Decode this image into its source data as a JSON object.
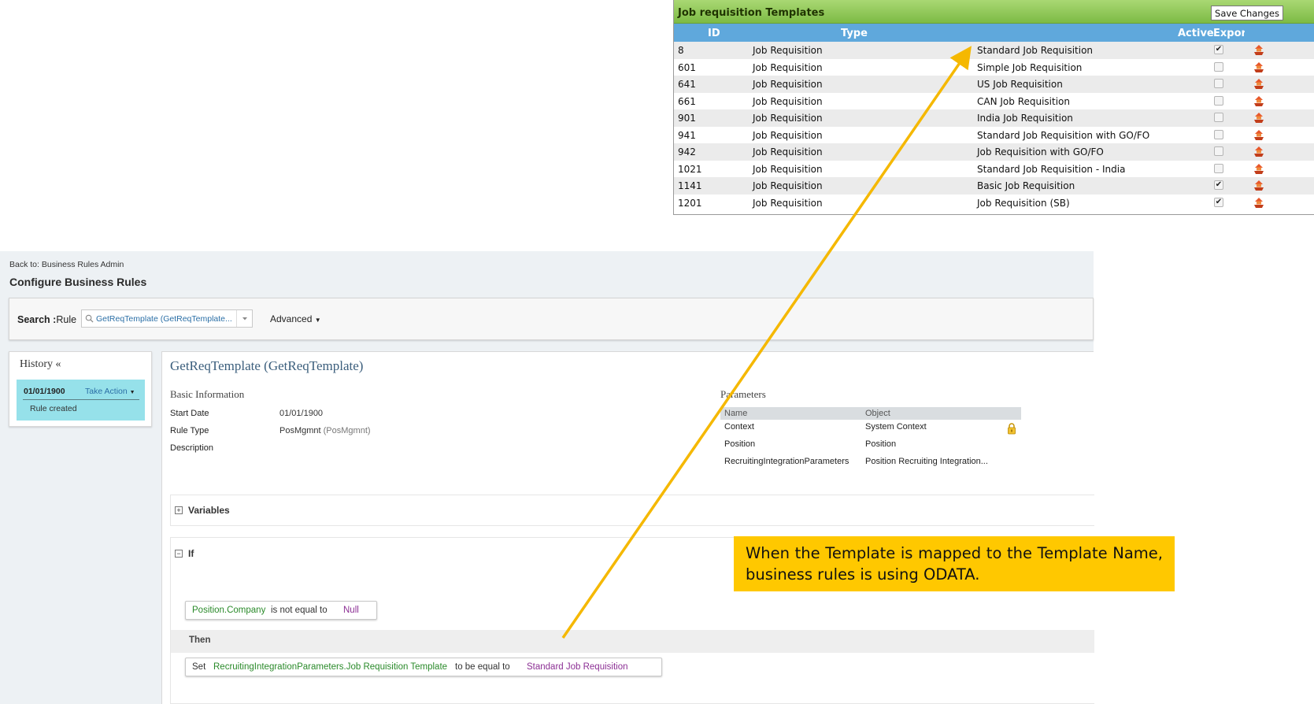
{
  "templates_panel": {
    "title": "Job requisition Templates",
    "save_label": "Save Changes",
    "columns": {
      "id": "ID",
      "type": "Type",
      "active": "Active",
      "export": "Export"
    },
    "rows": [
      {
        "id": "8",
        "type": "Job Requisition",
        "name": "Standard Job Requisition",
        "active": true
      },
      {
        "id": "601",
        "type": "Job Requisition",
        "name": "Simple Job Requisition",
        "active": false
      },
      {
        "id": "641",
        "type": "Job Requisition",
        "name": "US Job Requisition",
        "active": false
      },
      {
        "id": "661",
        "type": "Job Requisition",
        "name": "CAN Job Requisition",
        "active": false
      },
      {
        "id": "901",
        "type": "Job Requisition",
        "name": "India Job Requisition",
        "active": false
      },
      {
        "id": "941",
        "type": "Job Requisition",
        "name": "Standard Job Requisition with GO/FO",
        "active": false
      },
      {
        "id": "942",
        "type": "Job Requisition",
        "name": "Job Requisition with GO/FO",
        "active": false
      },
      {
        "id": "1021",
        "type": "Job Requisition",
        "name": "Standard Job Requisition - India",
        "active": false
      },
      {
        "id": "1141",
        "type": "Job Requisition",
        "name": "Basic Job Requisition",
        "active": true
      },
      {
        "id": "1201",
        "type": "Job Requisition",
        "name": "Job Requisition (SB)",
        "active": true
      }
    ],
    "export_icon": "export-icon",
    "header_color": "#7dbb45",
    "column_header_color": "#5fa8dc"
  },
  "page": {
    "back_link": "Back to: Business Rules Admin",
    "title": "Configure Business Rules",
    "search": {
      "label": "Search :",
      "scope": "Rule",
      "value": "GetReqTemplate (GetReqTemplate...",
      "icon": "search-icon"
    },
    "advanced_label": "Advanced",
    "history": {
      "title": "History «",
      "entry_date": "01/01/1900",
      "entry_action": "Take Action",
      "entry_note": "Rule created",
      "highlight_color": "#96e1ea"
    }
  },
  "rule": {
    "title": "GetReqTemplate (GetReqTemplate)",
    "basic_info_title": "Basic Information",
    "fields": {
      "start_date_label": "Start Date",
      "start_date": "01/01/1900",
      "rule_type_label": "Rule Type",
      "rule_type": "PosMgmnt",
      "rule_type_code": "(PosMgmnt)",
      "description_label": "Description"
    },
    "parameters": {
      "title": "Parameters",
      "head_name": "Name",
      "head_object": "Object",
      "rows": [
        {
          "name": "Context",
          "object": "System Context"
        },
        {
          "name": "Position",
          "object": "Position"
        },
        {
          "name": "RecruitingIntegrationParameters",
          "object": "Position Recruiting Integration..."
        }
      ],
      "lock_icon": "lock-icon"
    },
    "variables_label": "Variables",
    "if_label": "If",
    "condition": {
      "field": "Position.Company",
      "operator": "is not equal to",
      "value": "Null"
    },
    "then_label": "Then",
    "action": {
      "verb": "Set",
      "target": "RecruitingIntegrationParameters.Job Requisition Template",
      "operator": "to be equal to",
      "value": "Standard Job Requisition"
    }
  },
  "callout": {
    "text": "When the Template is mapped to the Template Name, business rules is using ODATA.",
    "color": "#ffc800",
    "arrow_color": "#f5b800"
  }
}
